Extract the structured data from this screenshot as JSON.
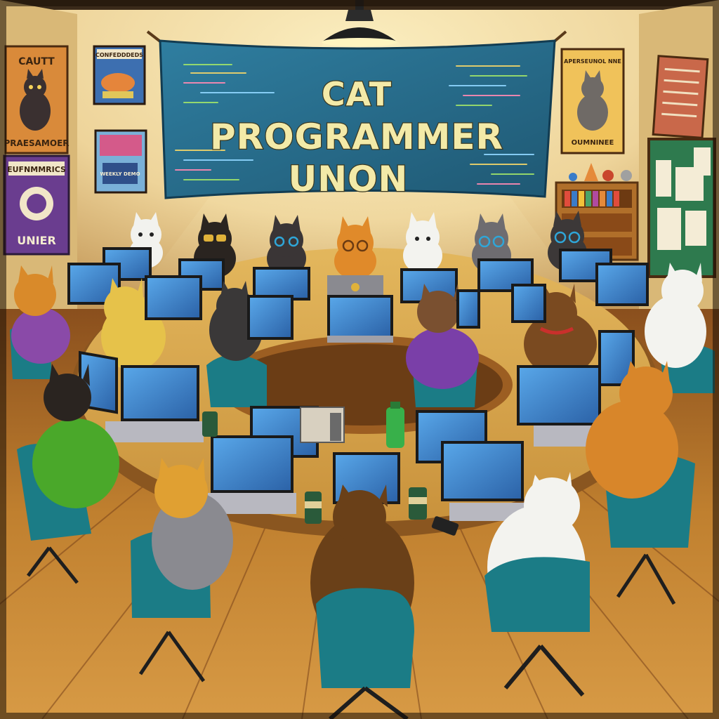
{
  "banner": {
    "line1": "CAT",
    "line2": "PROGRAMMER",
    "line3": "UNON"
  },
  "posters": {
    "top_left_title": "CAUTT",
    "top_left_caption": "PRAESAMOER",
    "mid_left_title": "EUFNMMRICS",
    "mid_left_caption": "UNIER",
    "small_poster_label": "CONFEDDDEDS",
    "chalk_poster_label": "WEEKLY DEMO",
    "top_right_title": "APERSEUNOL NNE",
    "top_right_caption": "OUMNINEE"
  },
  "palette": {
    "wall": "#f1dca0",
    "banner": "#2b6d8a",
    "floor": "#b5732c",
    "chair": "#1b7c86",
    "screen": "#3b82c9"
  }
}
